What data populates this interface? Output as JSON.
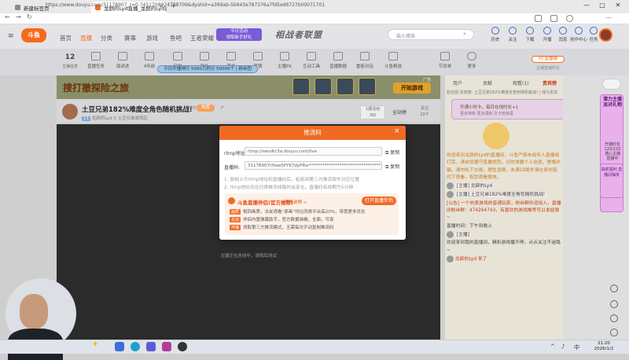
{
  "browser": {
    "tabs": [
      {
        "label": "新建标签页"
      },
      {
        "label": "龙颜的Lyd直播_龙颜的Lyd直播_斗鱼直"
      }
    ],
    "new_tab": "+",
    "url": "https://www.douyu.com/31178907_r=0.7451708924738709&dyshid=a399ab-5b943e787376a7fd5ed6727b00071701",
    "window_controls": [
      "—",
      "□",
      "✕"
    ]
  },
  "site": {
    "logo": "斗鱼",
    "nav": [
      "首页",
      "直播",
      "分类",
      "赛事",
      "游戏",
      "鱼吧",
      "王者荣耀"
    ],
    "nav_active_index": 1,
    "promo_line1": "今日活动",
    "promo_line2": "领取新手好礼",
    "banner_text": "相战者联盟",
    "search_placeholder": "猫头鹰猫",
    "header_icons": [
      "历史",
      "关注",
      "下载",
      "开播",
      "消息",
      "创作中心",
      "任务"
    ]
  },
  "toolbar": {
    "level": "12",
    "level_sub": "主播任务",
    "items": [
      "直播任务",
      "演讲进",
      "4年前",
      "守护",
      "时长",
      "签约",
      "竞猜",
      "主播PK",
      "互动工具",
      "直播数据",
      "重新对话",
      "斗鱼精选",
      "节目单",
      "更多"
    ],
    "task_badge": "今日开播排行 5000万积分 50000个 | 粉丝团",
    "pc_button": "PC直播端",
    "pc_sub": "主播直播时长"
  },
  "ad": {
    "headline": "搜打撤探险之旅",
    "play_button": "开始游戏",
    "ad_tag": "广告"
  },
  "stream": {
    "title": "土豆兄弟182%难度全角色随机挑战!",
    "hot_count": "34091",
    "hot_button": "热度",
    "tags": [
      "11",
      "龙颜的Lyd",
      "0",
      "土豆兄弟游戏区"
    ],
    "gift_label": "1期活动",
    "gift_count": "/60",
    "all_gifts": "全站榜",
    "follow_label": "关注",
    "follow_count": "10个",
    "tip": "主播正在连线中，请稍后测试"
  },
  "chat": {
    "tabs": [
      "用户",
      "贡献",
      "观看(1)",
      "贵宾榜"
    ],
    "active_tab_index": 3,
    "rank_line": "粉丝团 贵宾榜: 土豆兄弟182%难度全角色随机挑战! | 成为贵宾",
    "card_line1": "开通小时卡，每月在线时长+1",
    "card_line2": "更多特权 更多福利 打卡有惊喜",
    "messages": [
      {
        "cls": "sys",
        "text": "欢迎来到龙颜的Lyd的直播间，斗鱼严禁未成年人直播或打赏，请自觉遵守直播规范，切勿泄露个人信息，警惕诈骗，请勿私下交易，理性消费，未满18周岁请在家长陪同下观看，祝您观看愉快。"
      },
      {
        "cls": "",
        "text": "[主播] 龙颜的Lyd"
      },
      {
        "cls": "",
        "text": "[主播] 土豆兄弟182%难度全角色随机挑战!"
      },
      {
        "cls": "red",
        "text": "[公告] 一个热爱游戏的普通玩家，粉丝群欢迎加入，直播间粉丝群：474264743，有喜欢的游戏推荐可以发给我~"
      },
      {
        "cls": "",
        "text": "直播时间：下午到晚上"
      },
      {
        "cls": "",
        "text": "[主播]"
      },
      {
        "cls": "",
        "text": "欢迎来到我的直播间，精彩游戏播不停，点点关注不迷路~"
      },
      {
        "cls": "red",
        "text": "龙颜的Lyd 来了"
      }
    ]
  },
  "side": {
    "service_title": "潜力主播派对礼物",
    "service_sub": "开播时长 120/120 潜心主播 直播中",
    "service_bot": "抽奖福利 直播间抽奖"
  },
  "modal": {
    "title": "推流码",
    "close": "×",
    "rtmp_label": "rtmp地址:",
    "rtmp_value": "rtmp://sendtc3a.douyu.com/live",
    "key_label": "直播码:",
    "key_value": "31178907rHaw5PYK7dyPRsr****************************************************&ResmiEcognition",
    "copy_label": "复制",
    "note1": "1. 复制上方rtmp地址和直播码后，粘贴到第三方推流软件对应位置",
    "note2": "2. rtmp地址仅在切换推流线路时会变化，直播码有效期为5分钟",
    "helper_title": "斗鱼直播伴侣(官方推荐)",
    "helper_link": "使用说明 >",
    "helper_button": "打开直播伴侣",
    "helper_rows": [
      {
        "key": "画质",
        "text": "相同画质，水友观看“原画”时比同类平台高20%，带宽更多优化"
      },
      {
        "key": "互动",
        "text": "伴侣内置弹幕助手，官方数据准确，全面，可靠"
      },
      {
        "key": "开播",
        "text": "领取第三方推流模式，无需每次手动复制推流码"
      }
    ]
  },
  "taskbar": {
    "time": "21:20",
    "date": "2026/1/2",
    "tray": [
      "^",
      "♪",
      "中"
    ]
  },
  "colors": {
    "accent": "#f06a24",
    "douyu_orange": "#f56b1b",
    "player_bg": "#2b2b2b",
    "chat_bg": "#e8e3d7"
  }
}
